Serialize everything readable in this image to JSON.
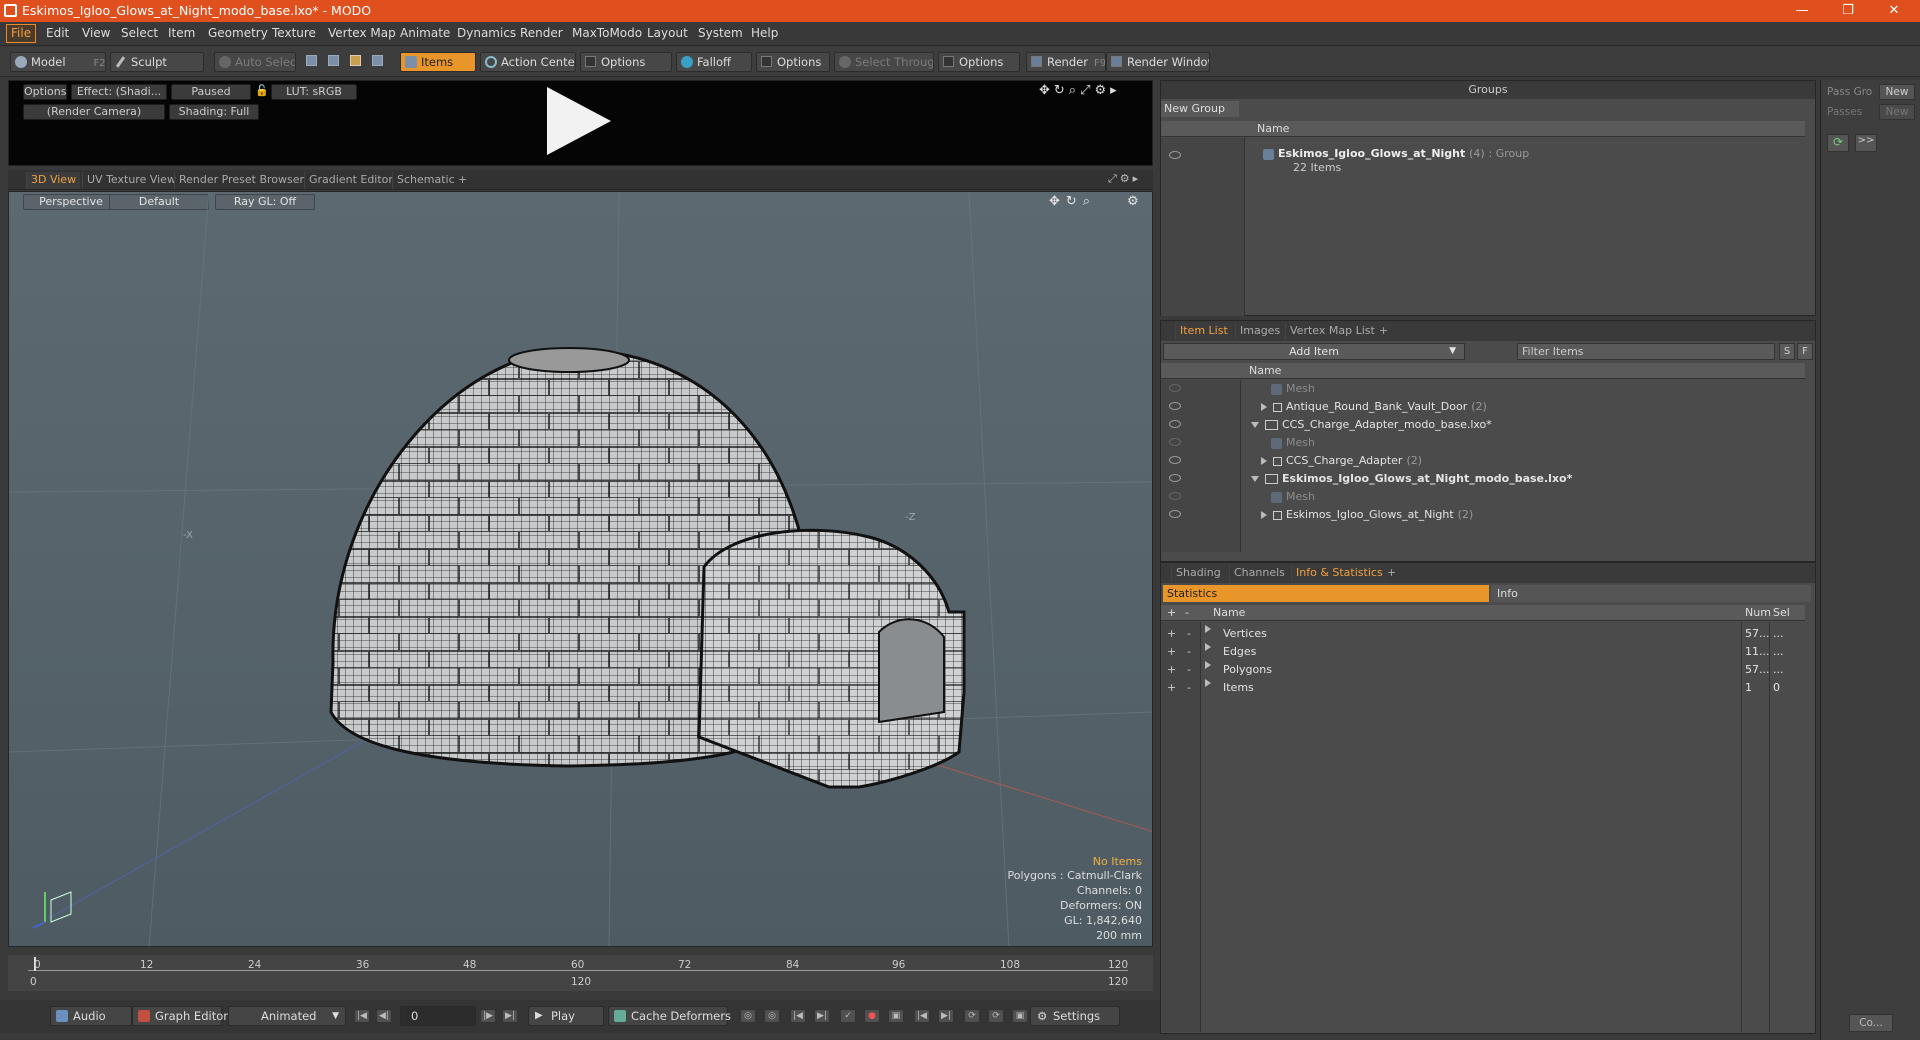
{
  "window": {
    "title": "Eskimos_Igloo_Glows_at_Night_modo_base.lxo* - MODO",
    "min": "—",
    "max": "❐",
    "close": "✕"
  },
  "menu": [
    "File",
    "Edit",
    "View",
    "Select",
    "Item",
    "Geometry",
    "Texture",
    "Vertex Map",
    "Animate",
    "Dynamics",
    "Render",
    "MaxToModo",
    "Layout",
    "System",
    "Help"
  ],
  "toolbar": {
    "model": "Model",
    "model_key": "F2",
    "sculpt": "Sculpt",
    "auto_select": "Auto Select",
    "items": "Items",
    "action_center": "Action Center",
    "options1": "Options",
    "falloff": "Falloff",
    "options2": "Options",
    "select_through": "Select Through",
    "options3": "Options",
    "render": "Render",
    "render_key": "F9",
    "render_window": "Render Window"
  },
  "render_preview": {
    "options": "Options",
    "effect": "Effect: (Shadi...",
    "paused": "Paused",
    "lut": "LUT: sRGB",
    "camera": "(Render Camera)",
    "shading": "Shading: Full"
  },
  "viewport_tabs": [
    "3D View",
    "UV Texture View",
    "Render Preset Browser",
    "Gradient Editor",
    "Schematic",
    "+"
  ],
  "viewport": {
    "perspective": "Perspective",
    "default": "Default",
    "raygl": "Ray GL: Off",
    "axis_x": "-X",
    "axis_z": "-Z",
    "info": {
      "no_items": "No Items",
      "polygons": "Polygons : Catmull-Clark",
      "channels": "Channels: 0",
      "deformers": "Deformers: ON",
      "gl": "GL: 1,842,640",
      "scale": "200 mm"
    }
  },
  "timeline": {
    "ticks_top": [
      "0",
      "12",
      "24",
      "36",
      "48",
      "60",
      "72",
      "84",
      "96",
      "108",
      "120"
    ],
    "ticks_bottom": [
      "0",
      "120",
      "120"
    ]
  },
  "bottombar": {
    "audio": "Audio",
    "graph_editor": "Graph Editor",
    "animated": "Animated",
    "frame": "0",
    "play": "Play",
    "cache": "Cache Deformers",
    "settings": "Settings"
  },
  "groups": {
    "title": "Groups",
    "new_group": "New Group",
    "col_name": "Name",
    "item_name": "Eskimos_Igloo_Glows_at_Night",
    "item_count": "(4)",
    "item_type": ": Group",
    "item_sub": "22 Items"
  },
  "pass": {
    "pass_gro": "Pass Gro",
    "new1": "New",
    "passes": "Passes",
    "new2": "New",
    "arrows": ">>",
    "co": "Co..."
  },
  "itemlist": {
    "tabs": [
      "Item List",
      "Images",
      "Vertex Map List",
      "+"
    ],
    "add_item": "Add Item",
    "filter": "Filter Items",
    "s": "S",
    "f": "F",
    "col_name": "Name",
    "rows": [
      {
        "label": "Mesh",
        "indent": 2,
        "kind": "mesh",
        "dim": true
      },
      {
        "label": "Antique_Round_Bank_Vault_Door",
        "count": "(2)",
        "indent": 1,
        "kind": "loc"
      },
      {
        "label": "CCS_Charge_Adapter_modo_base.lxo*",
        "indent": 0,
        "kind": "scene"
      },
      {
        "label": "Mesh",
        "indent": 2,
        "kind": "mesh",
        "dim": true
      },
      {
        "label": "CCS_Charge_Adapter",
        "count": "(2)",
        "indent": 1,
        "kind": "loc"
      },
      {
        "label": "Eskimos_Igloo_Glows_at_Night_modo_base.lxo*",
        "indent": 0,
        "kind": "scene",
        "bold": true
      },
      {
        "label": "Mesh",
        "indent": 2,
        "kind": "mesh",
        "dim": true
      },
      {
        "label": "Eskimos_Igloo_Glows_at_Night",
        "count": "(2)",
        "indent": 1,
        "kind": "loc"
      }
    ]
  },
  "stats": {
    "tabs": [
      "Shading",
      "Channels",
      "Info & Statistics",
      "+"
    ],
    "statistics": "Statistics",
    "info": "Info",
    "col_name": "Name",
    "col_num": "Num",
    "col_sel": "Sel",
    "rows": [
      {
        "name": "Vertices",
        "num": "57...",
        "sel": "..."
      },
      {
        "name": "Edges",
        "num": "11...",
        "sel": "..."
      },
      {
        "name": "Polygons",
        "num": "57...",
        "sel": "..."
      },
      {
        "name": "Items",
        "num": "1",
        "sel": "0"
      }
    ]
  },
  "colors": {
    "title_bg": "#e0501e",
    "accent": "#e8962a",
    "viewport_bg": "#5d6970"
  }
}
